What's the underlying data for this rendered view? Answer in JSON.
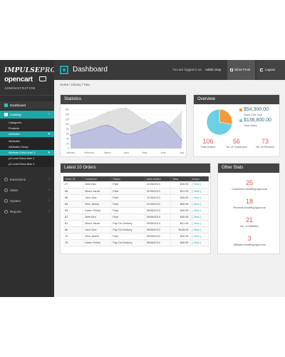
{
  "brand": {
    "impulse": "IMPULSE",
    "impulse_pro": "PRO",
    "name": "opencart",
    "subtitle": "Administration"
  },
  "topbar": {
    "title": "Dashboard",
    "logged_in_text": "You are logged in as",
    "username": "Admin.Guy",
    "store_front": "Store Front",
    "logout": "Logout"
  },
  "breadcrumb": "Home / Library / Tutu",
  "sidebar": {
    "dashboard": "Dashboard",
    "catalog": "Catalog",
    "catalog_items": [
      "Categories",
      "Products",
      "Attributes"
    ],
    "attribute_items": [
      "Attributes",
      "Attributes Group"
    ],
    "level3_items": [
      "Attribute Extra Level 3",
      "p3 Level Menu Item 1",
      "p3 Level Menu Item 2"
    ],
    "extensions": "Extensions",
    "sales": "Sales",
    "system": "System",
    "reports": "Reports"
  },
  "statistics": {
    "title": "Statistics"
  },
  "chart_data": {
    "type": "area",
    "x": [
      "January",
      "February",
      "March",
      "April",
      "May",
      "June",
      "July"
    ],
    "series": [
      {
        "values": [
          95,
          118,
          150,
          165,
          118,
          88,
          150
        ]
      },
      {
        "values": [
          55,
          75,
          95,
          60,
          80,
          110,
          35
        ]
      }
    ],
    "ylabels": [
      "160",
      "140",
      "120",
      "100",
      "80",
      "60",
      "40",
      "20",
      "0"
    ],
    "ylim": [
      0,
      170
    ],
    "colors": {
      "gray": "#dcdcdc",
      "blue": "#b9bbdf",
      "blue_stroke": "#9c9fd3"
    }
  },
  "overview": {
    "title": "Overview",
    "pie_values": [
      0.28,
      0.72
    ],
    "pie_colors": [
      "#f39a3c",
      "#6ccfe2"
    ],
    "legend": [
      {
        "value": "$54,300.00",
        "label": "Sales This Year",
        "color": "#f39a3c"
      },
      {
        "value": "$136,800.00",
        "label": "Total Sales",
        "color": "#6ccfe2"
      }
    ],
    "kpis": [
      {
        "value": "106",
        "label": "Total Orders"
      },
      {
        "value": "56",
        "label": "No. of Customers"
      },
      {
        "value": "73",
        "label": "No. of Reviews"
      }
    ]
  },
  "orders": {
    "title": "Latest 10 Orders",
    "columns": [
      "Order ID",
      "Customer",
      "Status",
      "Date Added",
      "Total",
      "Action"
    ],
    "rows": [
      [
        "87",
        "Beth Bov",
        "Paid",
        "21/06/2013",
        "$45.95",
        "[ View ]"
      ],
      [
        "86",
        "Bruce Jarvis",
        "Paid",
        "21/06/2013",
        "$21.05",
        "[ View ]"
      ],
      [
        "85",
        "John Doe",
        "Paid",
        "21/06/2013",
        "$45.95",
        "[ View ]"
      ],
      [
        "84",
        "Rich James",
        "Paid",
        "21/06/2013",
        "$45.95",
        "[ View ]"
      ],
      [
        "83",
        "Karen Polish",
        "Paid",
        "09/06/2013",
        "$45.95",
        "[ View ]"
      ],
      [
        "82",
        "Beth Bov",
        "Paid",
        "09/06/2013",
        "$45.95",
        "[ View ]"
      ],
      [
        "81",
        "Bruce Jarvis",
        "Pay On Delivery",
        "09/06/2013",
        "$21.05",
        "[ View ]"
      ],
      [
        "80",
        "John Doe",
        "Pay On Delivery",
        "09/06/2013",
        "$145.95",
        "[ View ]"
      ],
      [
        "79",
        "Rich James",
        "Paid",
        "09/06/2013",
        "$45.95",
        "[ View ]"
      ],
      [
        "78",
        "Karen Polish",
        "Pay On Delivery",
        "09/06/2013",
        "$45.95",
        "[ View ]"
      ]
    ]
  },
  "other_stats": {
    "title": "Other Stats",
    "items": [
      {
        "value": "25",
        "label": "Customers Awaiting Approval"
      },
      {
        "value": "18",
        "label": "Reviews Awaiting Approval"
      },
      {
        "value": "21",
        "label": "No. of Affiliates"
      },
      {
        "value": "3",
        "label": "Affiliates Awaiting Approval"
      }
    ]
  }
}
